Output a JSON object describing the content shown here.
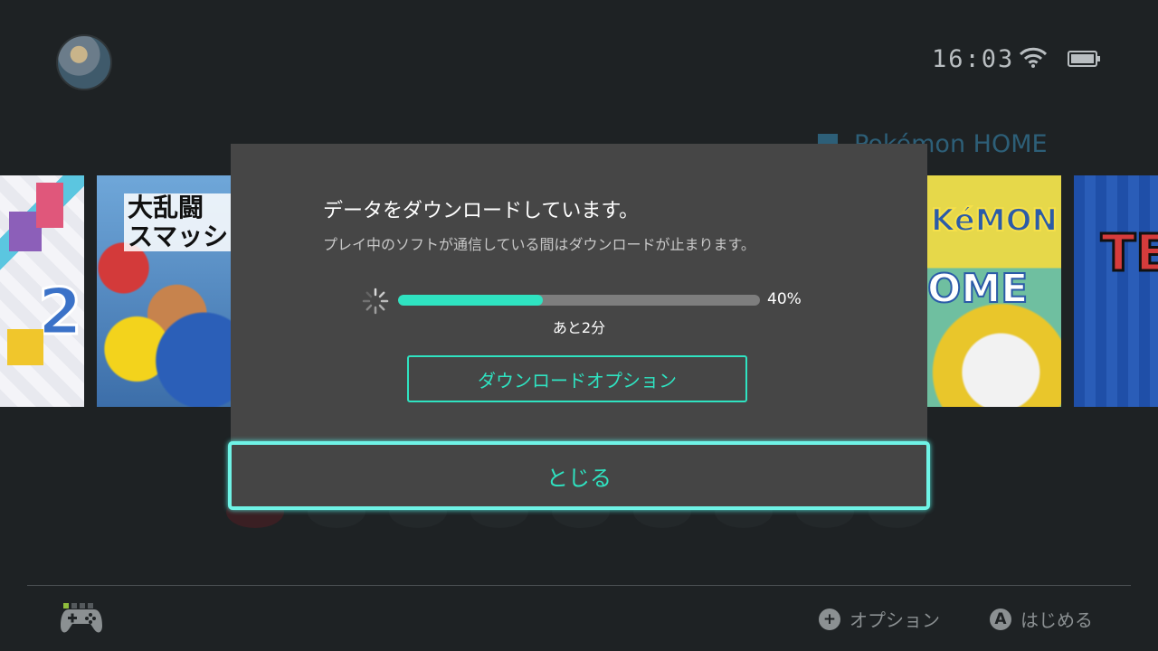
{
  "status_bar": {
    "time": "16:03",
    "wifi_icon": "wifi-icon",
    "battery_icon": "battery-icon"
  },
  "home": {
    "selected_title": "Pokémon HOME",
    "tiles": [
      {
        "name": "tetris-99"
      },
      {
        "name": "super-smash-bros-ultimate",
        "text": "大乱闘\nスマッシュブラ"
      },
      {
        "name": "pokemon-home",
        "text_top": "KéMON",
        "text_bottom": "OME"
      },
      {
        "name": "tetris-tile",
        "text": "TE"
      }
    ]
  },
  "dialog": {
    "title": "データをダウンロードしています。",
    "subtitle": "プレイ中のソフトが通信している間はダウンロードが止まります。",
    "progress_percent": 40,
    "progress_label": "40%",
    "remaining": "あと2分",
    "option_button": "ダウンロードオプション",
    "close_button": "とじる",
    "accent_color": "#2fe3c1"
  },
  "footer": {
    "options_icon": "plus-icon",
    "options_label": "オプション",
    "start_icon": "a-button-icon",
    "start_glyph": "A",
    "start_label": "はじめる",
    "controller_icon": "controller-icon"
  }
}
